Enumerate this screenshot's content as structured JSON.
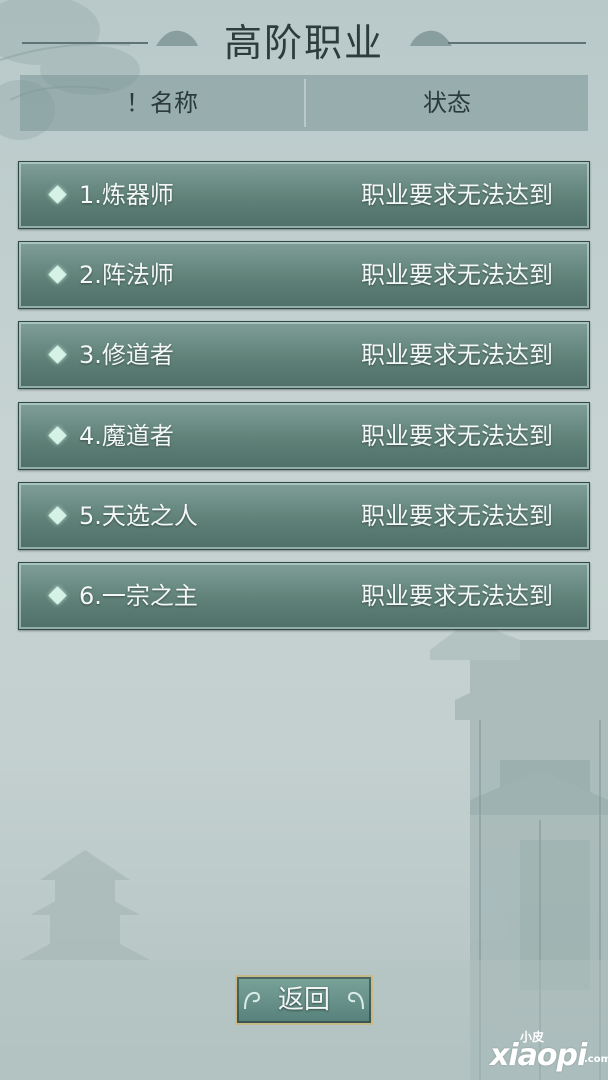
{
  "header": {
    "title": "高阶职业"
  },
  "columns": {
    "name": "！名称",
    "status": "状态"
  },
  "careers": [
    {
      "name": "1.炼器师",
      "status": "职业要求无法达到"
    },
    {
      "name": "2.阵法师",
      "status": "职业要求无法达到"
    },
    {
      "name": "3.修道者",
      "status": "职业要求无法达到"
    },
    {
      "name": "4.魔道者",
      "status": "职业要求无法达到"
    },
    {
      "name": "5.天选之人",
      "status": "职业要求无法达到"
    },
    {
      "name": "6.一宗之主",
      "status": "职业要求无法达到"
    }
  ],
  "footer": {
    "back_label": "返回"
  },
  "watermark": {
    "small": "小皮",
    "main": "xiaopi",
    "suffix": ".com"
  }
}
